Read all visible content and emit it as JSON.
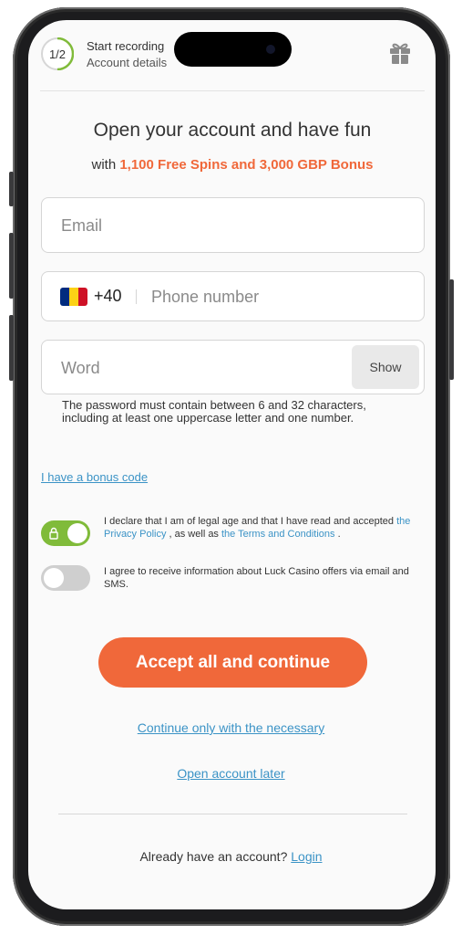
{
  "progress": {
    "step": "1/2",
    "title": "Start recording",
    "subtitle": "Account details"
  },
  "icons": {
    "gift": "gift-icon",
    "lock": "lock-icon",
    "flag": "romania-flag-icon"
  },
  "headline": "Open your account and have fun",
  "subline": {
    "prefix": "with ",
    "highlight": "1,100 Free Spins and 3,000 GBP Bonus"
  },
  "form": {
    "email_placeholder": "Email",
    "phone_code": "+40",
    "phone_placeholder": "Phone number",
    "password_placeholder": "Word",
    "show_label": "Show",
    "password_hint": "The password must contain between 6 and 32 characters, including at least one uppercase letter and one number."
  },
  "bonus_link": "I have a bonus code",
  "consents": {
    "legal_age": {
      "checked": true,
      "text_1": "I declare that I am of legal age and that I have read and accepted ",
      "privacy_link": "the Privacy Policy",
      "text_2": " , as well as ",
      "terms_link": "the Terms and Conditions",
      "text_3": " ."
    },
    "marketing": {
      "checked": false,
      "text": "I agree to receive information about Luck Casino offers via email and SMS."
    }
  },
  "actions": {
    "accept_all": "Accept all and continue",
    "necessary_only": "Continue only with the necessary",
    "open_later": "Open account later"
  },
  "footer": {
    "already": "Already have an account? ",
    "login": "Login"
  },
  "colors": {
    "accent": "#f0683a",
    "link": "#3b93c6",
    "toggle_on": "#80bb3a",
    "toggle_off": "#cfcfcf",
    "flag": [
      "#002b7f",
      "#fcd116",
      "#ce1126"
    ]
  }
}
